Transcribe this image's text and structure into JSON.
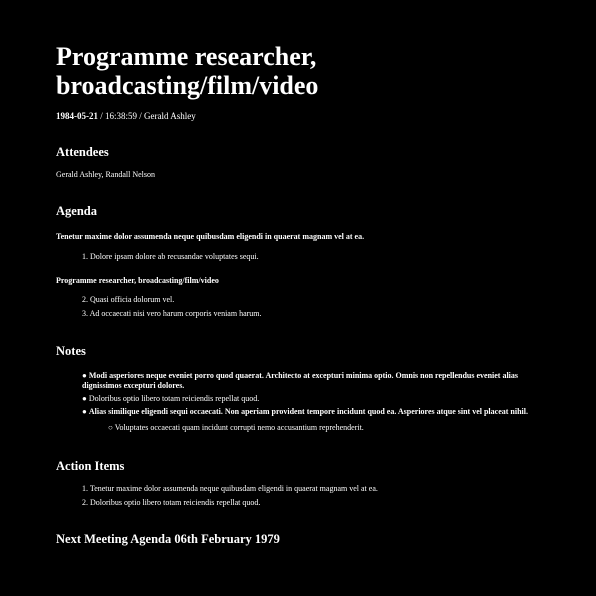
{
  "title_line1": "Programme researcher,",
  "title_line2": "broadcasting/film/video",
  "meta": {
    "date": "1984-05-21",
    "sep1": " / ",
    "time": "16:38:59",
    "sep2": " / ",
    "author": "Gerald Ashley"
  },
  "attendees": {
    "heading": "Attendees",
    "names": "Gerald Ashley, Randall Nelson"
  },
  "agenda": {
    "heading": "Agenda",
    "section1": {
      "title": "Tenetur maxime dolor assumenda neque quibusdam eligendi in quaerat magnam vel at ea.",
      "items": [
        {
          "num": "1.",
          "text": "Dolore ipsam dolore ab recusandae voluptates sequi."
        }
      ]
    },
    "section2": {
      "title": "Programme researcher, broadcasting/film/video",
      "items": [
        {
          "num": "2.",
          "text": "Quasi officia dolorum vel."
        },
        {
          "num": "3.",
          "text": "Ad occaecati nisi vero harum corporis veniam harum."
        }
      ]
    }
  },
  "notes": {
    "heading": "Notes",
    "bullet": "●",
    "sub_bullet": "○",
    "items": [
      {
        "text": "Modi asperiores neque eveniet porro quod quaerat. Architecto at excepturi minima optio. Omnis non repellendus eveniet alias dignissimos excepturi dolores."
      },
      {
        "text": "Doloribus optio libero totam reiciendis repellat quod."
      },
      {
        "text": "Alias similique eligendi sequi occaecati. Non aperiam provident tempore incidunt quod ea. Asperiores atque sint vel placeat nihil."
      }
    ],
    "subitem": "Voluptates occaecati quam incidunt corrupti nemo accusantium reprehenderit."
  },
  "action_items": {
    "heading": "Action Items",
    "items": [
      {
        "num": "1.",
        "text": "Tenetur maxime dolor assumenda neque quibusdam eligendi in quaerat magnam vel at ea."
      },
      {
        "num": "2.",
        "text": "Doloribus optio libero totam reiciendis repellat quod."
      }
    ]
  },
  "next_meeting": "Next Meeting Agenda 06th February 1979"
}
